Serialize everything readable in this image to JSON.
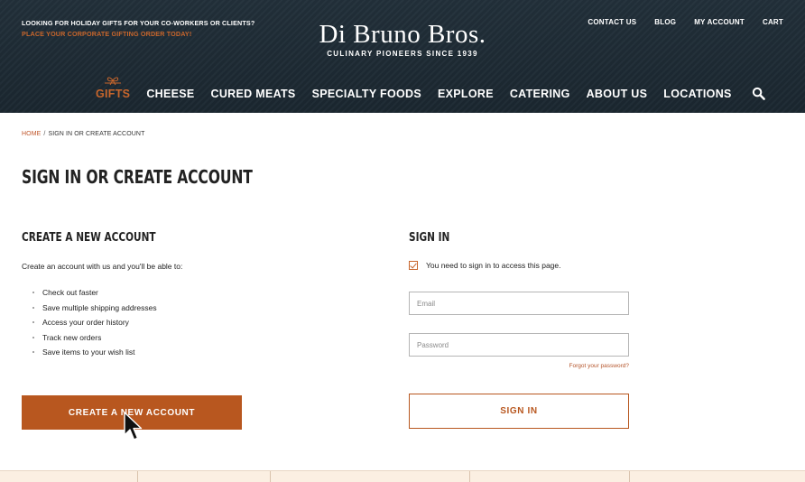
{
  "header": {
    "promo_line1": "LOOKING FOR HOLIDAY GIFTS FOR YOUR CO-WORKERS OR CLIENTS?",
    "promo_line2": "PLACE YOUR CORPORATE GIFTING ORDER TODAY!",
    "logo_name": "Di Bruno Bros.",
    "logo_tagline": "CULINARY PIONEERS SINCE 1939",
    "utility_links": [
      "CONTACT US",
      "BLOG",
      "MY ACCOUNT",
      "CART"
    ],
    "nav_items": [
      "GIFTS",
      "CHEESE",
      "CURED MEATS",
      "SPECIALTY FOODS",
      "EXPLORE",
      "CATERING",
      "ABOUT US",
      "LOCATIONS"
    ],
    "active_nav": "GIFTS",
    "search_icon": "search-icon"
  },
  "breadcrumb": {
    "home": "HOME",
    "separator": "/",
    "current": "SIGN IN OR CREATE ACCOUNT"
  },
  "page_title": "SIGN IN OR CREATE ACCOUNT",
  "create_account": {
    "title": "CREATE A NEW ACCOUNT",
    "intro": "Create an account with us and you'll be able to:",
    "benefits": [
      "Check out faster",
      "Save multiple shipping addresses",
      "Access your order history",
      "Track new orders",
      "Save items to your wish list"
    ],
    "button_label": "CREATE A NEW ACCOUNT"
  },
  "sign_in": {
    "title": "SIGN IN",
    "notice": "You need to sign in to access this page.",
    "email_placeholder": "Email",
    "password_placeholder": "Password",
    "forgot_label": "Forgot your password?",
    "button_label": "SIGN IN"
  },
  "colors": {
    "accent": "#b8571f",
    "header_bg": "#1e2a33",
    "footer_strip": "#fbefe2"
  }
}
